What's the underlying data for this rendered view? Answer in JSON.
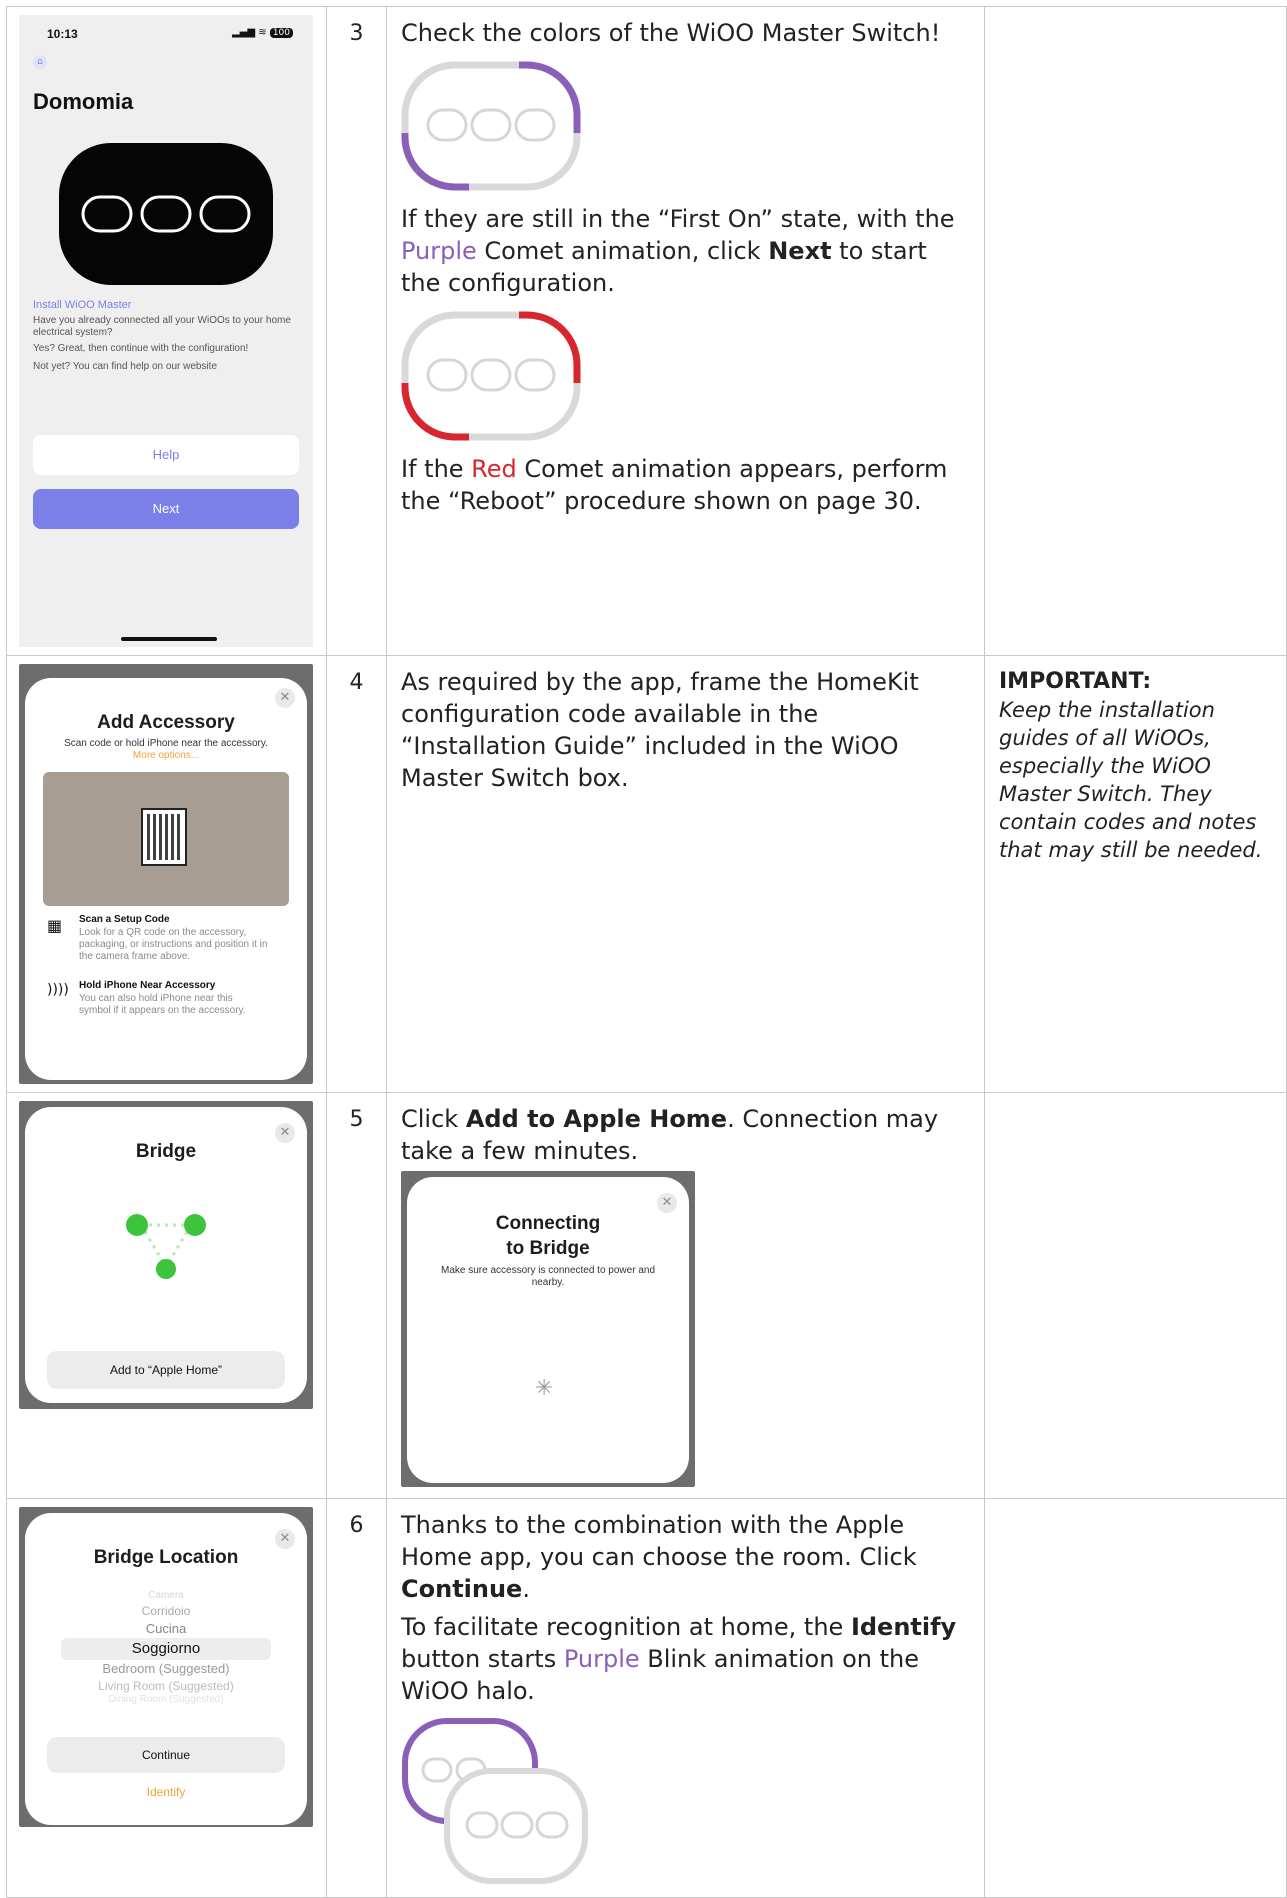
{
  "colors": {
    "purple": "#8b5fb8",
    "red": "#d8262f",
    "ios_blue": "#7b7fe8",
    "green": "#3cc43c"
  },
  "step3": {
    "number": "3",
    "line1": "Check the colors of the WiOO Master Switch!",
    "p2_a": "If they are still in the “First On” state, with the ",
    "p2_purple": "Purple",
    "p2_b": " Comet animation, click ",
    "p2_bold": "Next",
    "p2_c": " to start the configuration.",
    "p3_a": "If the ",
    "p3_red": "Red",
    "p3_b": " Comet animation appears, perform the “Reboot” procedure shown on page 30.",
    "phone": {
      "time": "10:13",
      "battery": "100",
      "title": "Domomia",
      "link": "Install WiOO Master",
      "text1": "Have you already connected all your WiOOs to your home electrical system?",
      "text2": "Yes? Great, then continue with the configuration!",
      "text3": "Not yet? You can find help on our website",
      "help_button": "Help",
      "next_button": "Next"
    }
  },
  "step4": {
    "number": "4",
    "text": "As required by the app, frame the HomeKit configuration code available in the “Installation Guide” included in the WiOO Master Switch box.",
    "note_head": "IMPORTANT:",
    "note_body": "Keep the installation guides of all WiOOs, especially the WiOO Master Switch. They contain codes and notes that may still be needed.",
    "phone": {
      "title": "Add Accessory",
      "subtitle": "Scan code or hold iPhone near the accessory.",
      "more": "More options...",
      "opt1_title": "Scan a Setup Code",
      "opt1_text": "Look for a QR code on the accessory, packaging, or instructions and position it in the camera frame above.",
      "opt2_title": "Hold iPhone Near Accessory",
      "opt2_text": "You can also hold iPhone near this symbol if it appears on the accessory."
    }
  },
  "step5": {
    "number": "5",
    "text_a": "Click ",
    "text_bold": "Add to Apple Home",
    "text_b": ". Connection may take a few minutes.",
    "phone": {
      "title": "Bridge",
      "button": "Add to “Apple Home”"
    },
    "connecting": {
      "title1": "Connecting",
      "title2": "to Bridge",
      "text": "Make sure accessory is connected to power and nearby."
    }
  },
  "step6": {
    "number": "6",
    "p1_a": "Thanks to the combination with the Apple Home app, you can choose the room. Click ",
    "p1_bold": "Continue",
    "p1_b": ".",
    "p2_a": "To facilitate recognition at home, the ",
    "p2_bold": "Identify",
    "p2_b": " button starts ",
    "p2_purple": "Purple",
    "p2_c": " Blink animation on the WiOO halo.",
    "phone": {
      "title": "Bridge Location",
      "rooms": [
        "Camera",
        "Corridoio",
        "Cucina",
        "Soggiorno",
        "Bedroom (Suggested)",
        "Living Room (Suggested)",
        "Dining Room (Suggested)"
      ],
      "continue": "Continue",
      "identify": "Identify"
    }
  }
}
